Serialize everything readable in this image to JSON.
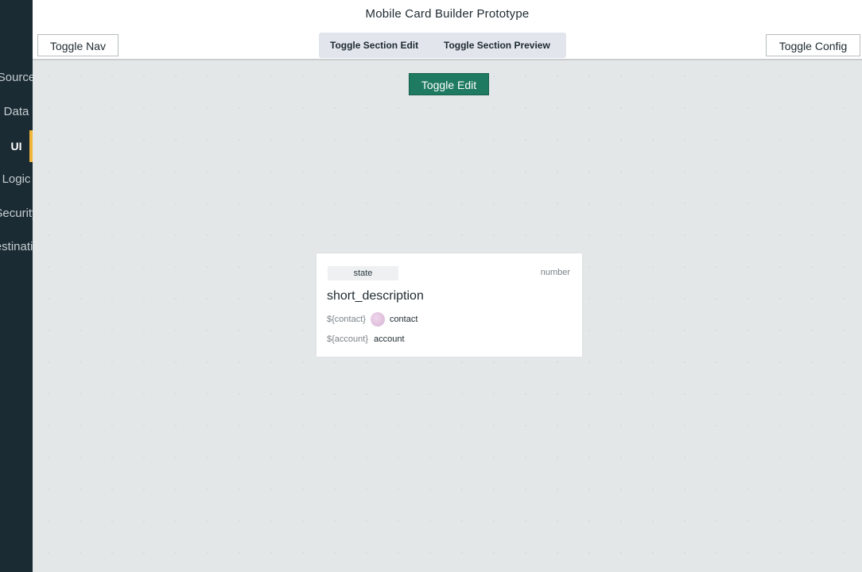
{
  "sidebar": {
    "items": [
      {
        "label": "Source",
        "active": false
      },
      {
        "label": "Data",
        "active": false
      },
      {
        "label": "UI",
        "active": true
      },
      {
        "label": "Logic",
        "active": false
      },
      {
        "label": "Security",
        "active": false
      },
      {
        "label": "Destination",
        "active": false
      }
    ]
  },
  "header": {
    "title": "Mobile Card Builder Prototype",
    "toggle_nav": "Toggle Nav",
    "toggle_section_edit": "Toggle Section Edit",
    "toggle_section_preview": "Toggle Section Preview",
    "toggle_config": "Toggle Config"
  },
  "canvas": {
    "toggle_edit": "Toggle Edit",
    "card": {
      "state": "state",
      "number": "number",
      "short_description": "short_description",
      "contact_var": "${contact}",
      "contact_value": "contact",
      "account_var": "${account}",
      "account_value": "account"
    }
  },
  "colors": {
    "sidebar_bg": "#1b2b33",
    "active_indicator": "#f0b63a",
    "primary_button": "#1f7a62",
    "canvas_bg": "#e4e7e7"
  }
}
